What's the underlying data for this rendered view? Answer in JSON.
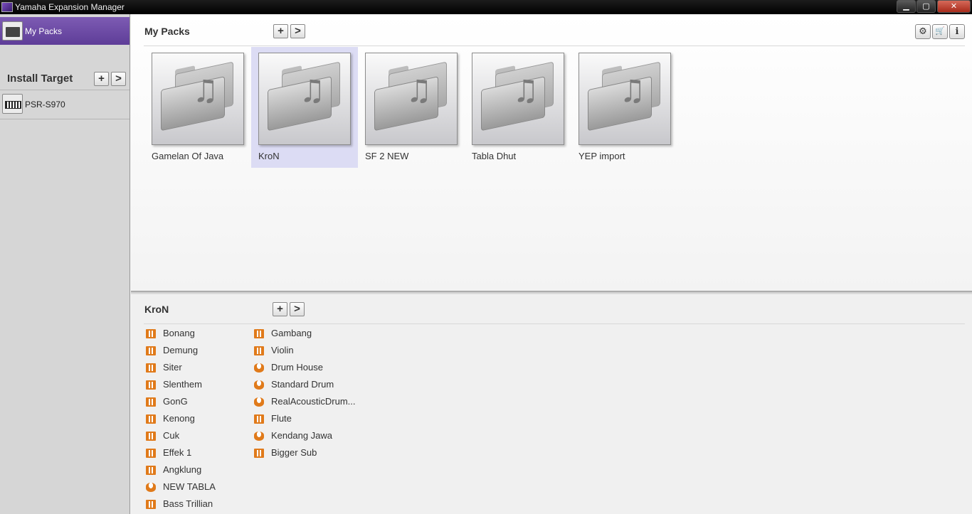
{
  "window": {
    "title": "Yamaha Expansion Manager",
    "controls": {
      "minimize": "▁",
      "maximize": "▢",
      "close": "✕"
    }
  },
  "sidebar": {
    "my_packs_label": "My Packs",
    "install_target_title": "Install Target",
    "add_label": "+",
    "go_label": ">",
    "device_label": "PSR-S970"
  },
  "packs_panel": {
    "title": "My Packs",
    "add_label": "+",
    "go_label": ">",
    "tools": {
      "settings": "⚙",
      "cart": "🛒",
      "info": "ℹ"
    },
    "packs": [
      {
        "name": "Gamelan Of Java",
        "selected": false
      },
      {
        "name": "KroN",
        "selected": true
      },
      {
        "name": "SF 2 NEW",
        "selected": false
      },
      {
        "name": "Tabla Dhut",
        "selected": false
      },
      {
        "name": "YEP import",
        "selected": false
      }
    ]
  },
  "pack_detail": {
    "title": "KroN",
    "add_label": "+",
    "go_label": ">",
    "column1": [
      {
        "name": "Bonang",
        "icon": "keyboard-icon"
      },
      {
        "name": "Demung",
        "icon": "keyboard-icon"
      },
      {
        "name": "Siter",
        "icon": "keyboard-icon"
      },
      {
        "name": "Slenthem",
        "icon": "keyboard-icon"
      },
      {
        "name": "GonG",
        "icon": "keyboard-icon"
      },
      {
        "name": "Kenong",
        "icon": "keyboard-icon"
      },
      {
        "name": "Cuk",
        "icon": "keyboard-icon"
      },
      {
        "name": "Effek 1",
        "icon": "keyboard-icon"
      },
      {
        "name": "Angklung",
        "icon": "keyboard-icon"
      },
      {
        "name": "NEW TABLA",
        "icon": "drum-icon"
      },
      {
        "name": "Bass Trillian",
        "icon": "keyboard-icon"
      }
    ],
    "column2": [
      {
        "name": "Gambang",
        "icon": "keyboard-icon"
      },
      {
        "name": "Violin",
        "icon": "keyboard-icon"
      },
      {
        "name": "Drum House",
        "icon": "drum-icon"
      },
      {
        "name": "Standard Drum",
        "icon": "drum-icon"
      },
      {
        "name": "RealAcousticDrum...",
        "icon": "drum-icon"
      },
      {
        "name": "Flute",
        "icon": "keyboard-icon"
      },
      {
        "name": "Kendang Jawa",
        "icon": "drum-icon"
      },
      {
        "name": "Bigger Sub",
        "icon": "keyboard-icon"
      }
    ]
  },
  "colors": {
    "accent_purple": "#6a4aa6",
    "selection": "#dcdcf4",
    "voice_icon_orange": "#e07a1a"
  }
}
